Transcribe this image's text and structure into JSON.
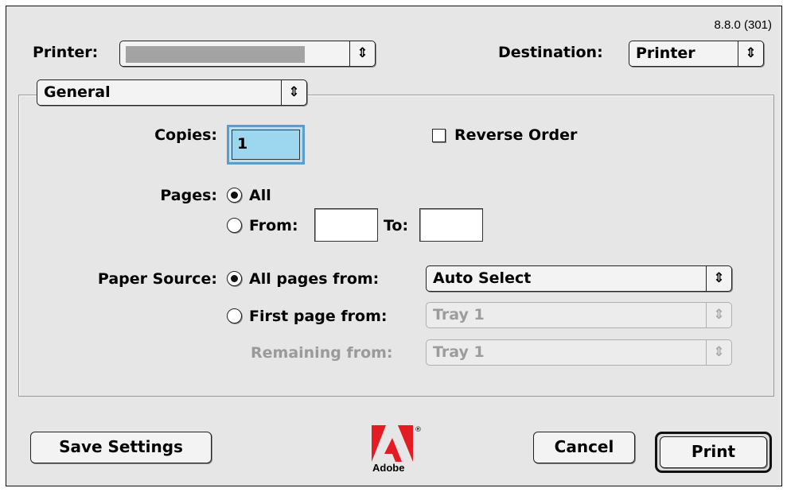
{
  "version": "8.8.0 (301)",
  "printer": {
    "label": "Printer:",
    "value": ""
  },
  "destination": {
    "label": "Destination:",
    "value": "Printer"
  },
  "panel_menu": {
    "value": "General"
  },
  "copies": {
    "label": "Copies:",
    "value": "1"
  },
  "reverse_order": {
    "label": "Reverse Order",
    "checked": false
  },
  "pages": {
    "label": "Pages:",
    "all_label": "All",
    "from_label": "From:",
    "to_label": "To:",
    "from_value": "",
    "to_value": "",
    "selected": "all"
  },
  "paper_source": {
    "label": "Paper Source:",
    "all_pages_label": "All pages from:",
    "all_pages_value": "Auto Select",
    "first_page_label": "First page from:",
    "first_page_value": "Tray 1",
    "remaining_label": "Remaining from:",
    "remaining_value": "Tray 1",
    "selected": "all_pages"
  },
  "buttons": {
    "save_settings": "Save Settings",
    "cancel": "Cancel",
    "print": "Print"
  },
  "logo": {
    "name": "adobe-logo",
    "text": "Adobe",
    "reg": "®",
    "color": "#e31b23"
  },
  "arrows_glyph": "⇕"
}
